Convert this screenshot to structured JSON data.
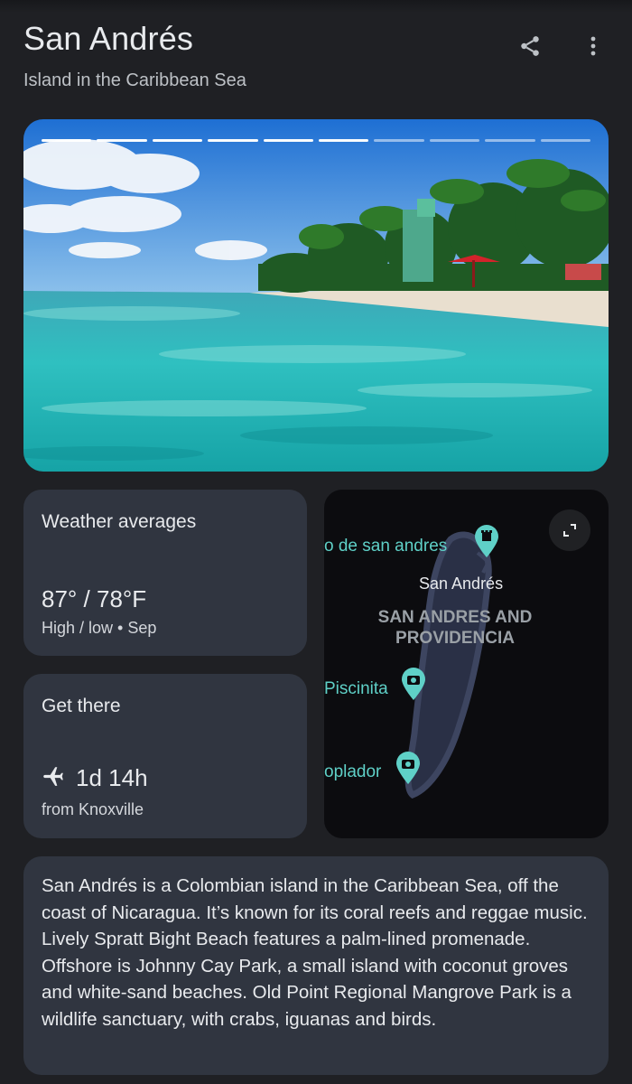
{
  "header": {
    "title": "San Andrés",
    "subtitle": "Island in the Caribbean Sea",
    "share_icon": "share-icon",
    "more_icon": "more-vert-icon"
  },
  "hero": {
    "slide_count": 10,
    "slides_viewed": 6
  },
  "weather": {
    "title": "Weather averages",
    "temps": "87° / 78°F",
    "caption": "High / low • Sep"
  },
  "travel": {
    "title": "Get there",
    "icon": "airplane-icon",
    "duration": "1d 14h",
    "origin": "from Knoxville"
  },
  "map": {
    "labels": {
      "landmark": "o de san andres",
      "city": "San Andrés",
      "region": "SAN ANDRES AND PROVIDENCIA",
      "poi1": "Piscinita",
      "poi2": "oplador"
    },
    "expand_icon": "expand-icon"
  },
  "description": "San Andrés is a Colombian island in the Caribbean Sea, off the coast of Nicaragua. It’s known for its coral reefs and reggae music. Lively Spratt Bight Beach features a palm-lined promenade. Offshore is Johnny Cay Park, a small island with coconut groves and white-sand beaches. Old Point Regional Mangrove Park is a wildlife sanctuary, with crabs, iguanas and birds.",
  "colors": {
    "background": "#1f2024",
    "card": "#303540",
    "map_accent": "#5fd0c7"
  }
}
